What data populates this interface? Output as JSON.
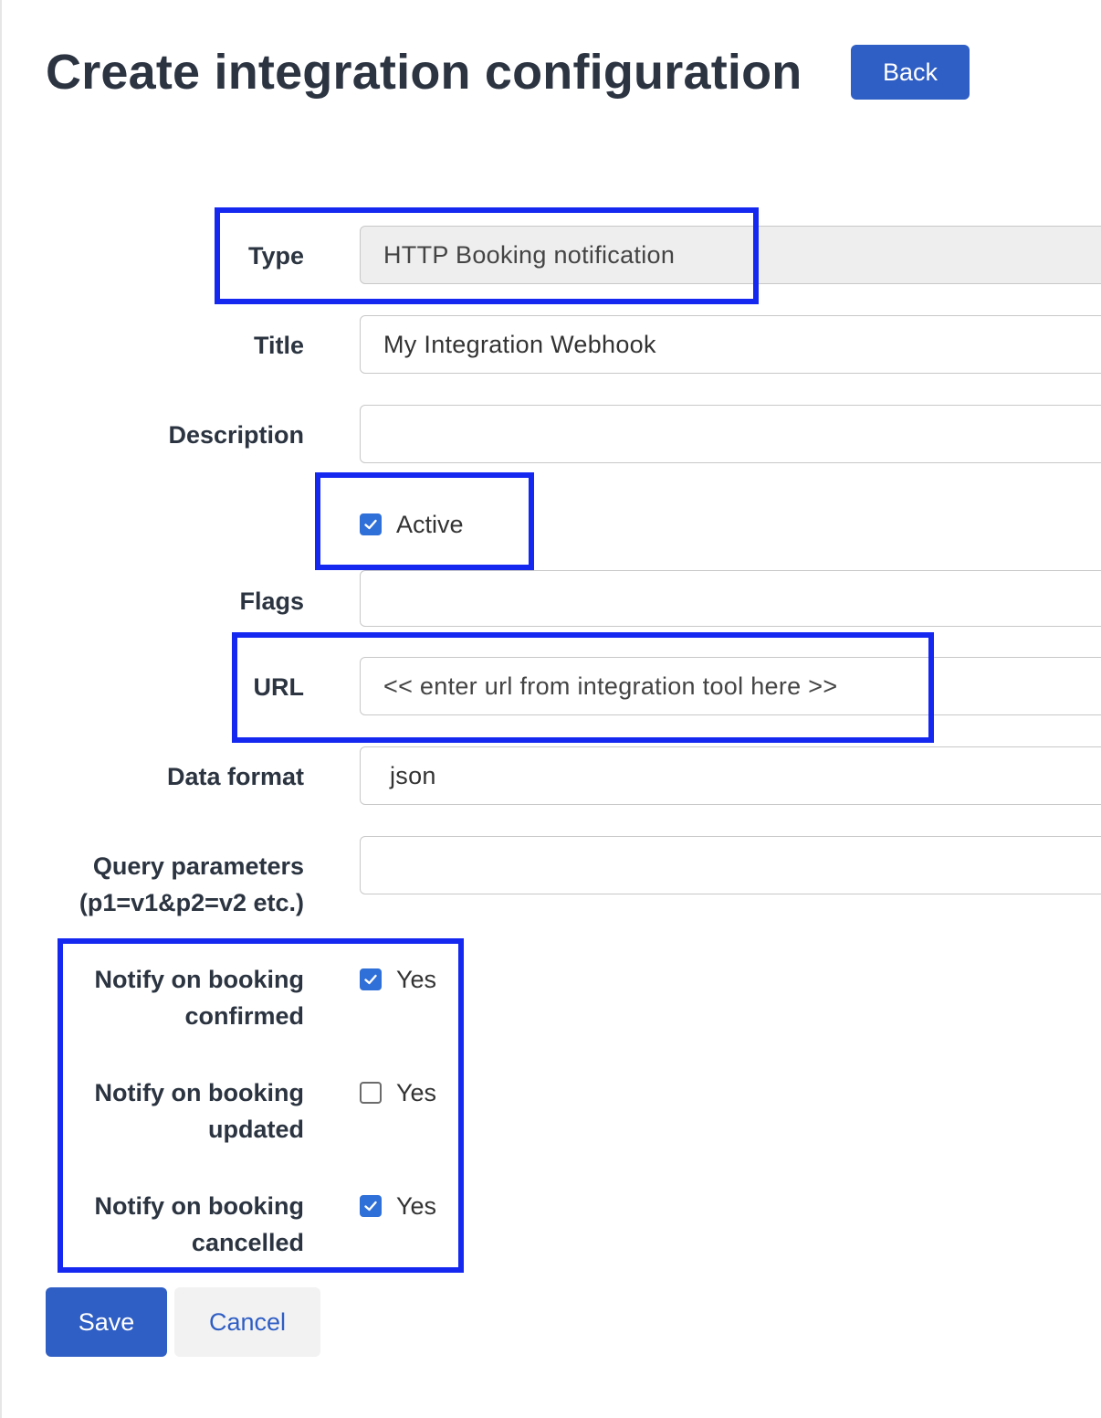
{
  "page": {
    "title": "Create integration configuration",
    "back_label": "Back"
  },
  "form": {
    "type": {
      "label": "Type",
      "value": "HTTP Booking notification"
    },
    "title": {
      "label": "Title",
      "value": "My Integration Webhook"
    },
    "description": {
      "label": "Description",
      "value": ""
    },
    "active": {
      "label": "Active",
      "checked": true
    },
    "flags": {
      "label": "Flags",
      "value": ""
    },
    "url": {
      "label": "URL",
      "value": "<< enter url from integration tool here >>"
    },
    "data_format": {
      "label": "Data format",
      "value": "json"
    },
    "query_parameters": {
      "label_line1": "Query parameters",
      "label_line2": "(p1=v1&p2=v2 etc.)",
      "value": ""
    },
    "notify_confirmed": {
      "label_line1": "Notify on booking",
      "label_line2": "confirmed",
      "option": "Yes",
      "checked": true
    },
    "notify_updated": {
      "label_line1": "Notify on booking",
      "label_line2": "updated",
      "option": "Yes",
      "checked": false
    },
    "notify_cancelled": {
      "label_line1": "Notify on booking",
      "label_line2": "cancelled",
      "option": "Yes",
      "checked": true
    }
  },
  "actions": {
    "save_label": "Save",
    "cancel_label": "Cancel"
  },
  "colors": {
    "primary": "#2f5ec4",
    "checkbox_checked": "#2f6fd8",
    "highlight": "#1428f0"
  }
}
